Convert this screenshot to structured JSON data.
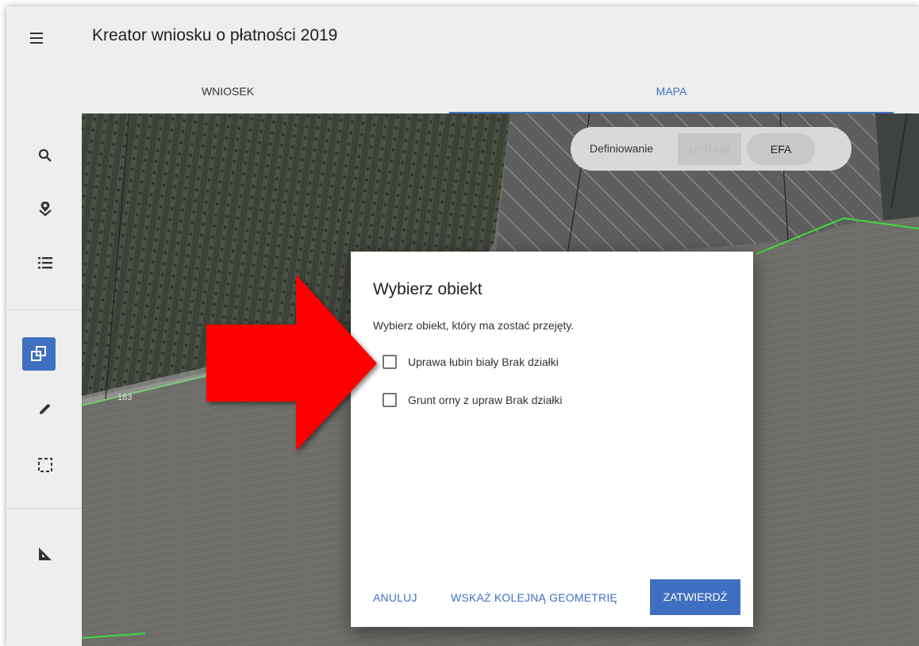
{
  "app": {
    "title": "Kreator wniosku o płatności 2019"
  },
  "tabs": [
    {
      "label": "WNIOSEK",
      "active": false
    },
    {
      "label": "MAPA",
      "active": true
    }
  ],
  "toolbar": {
    "icons": [
      "search-icon",
      "map-layers-icon",
      "list-icon",
      "copy-geometry-icon",
      "pencil-icon",
      "select-area-icon",
      "ruler-icon"
    ]
  },
  "map": {
    "parcel_label": "183",
    "toggle": {
      "label": "Definiowanie",
      "option1": "UPRAW",
      "option2": "EFA"
    }
  },
  "dialog": {
    "title": "Wybierz obiekt",
    "text": "Wybierz obiekt, który ma zostać przejęty.",
    "options": [
      {
        "label": "Uprawa łubin biały Brak działki",
        "checked": false
      },
      {
        "label": "Grunt orny z upraw Brak działki",
        "checked": false
      }
    ],
    "buttons": {
      "cancel": "ANULUJ",
      "next": "WSKAŻ KOLEJNĄ GEOMETRIĘ",
      "confirm": "ZATWIERDŹ"
    }
  },
  "colors": {
    "accent": "#3f6fc0",
    "annotation": "#ff0000",
    "parcel_border": "#3ddc3d"
  }
}
